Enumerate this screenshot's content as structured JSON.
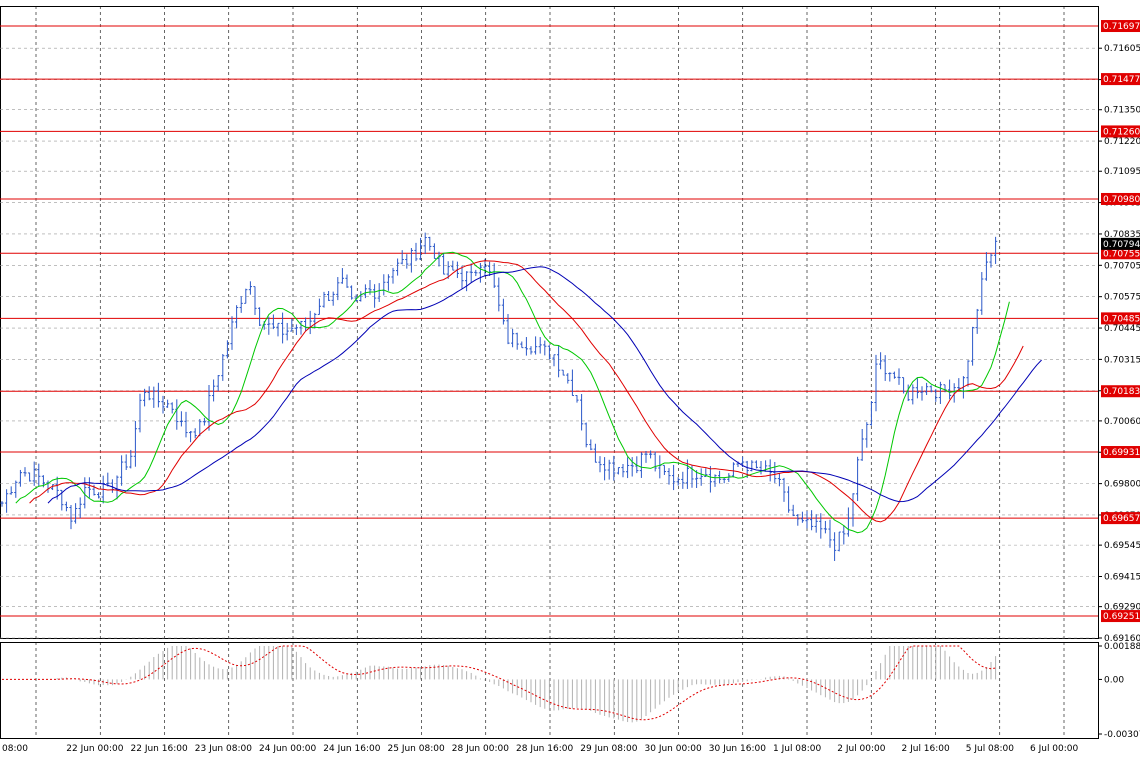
{
  "chart_data": [
    {
      "type": "line",
      "subtype": "candlestick-price-chart",
      "ylim": [
        0.6916,
        0.7178
      ],
      "y_ticks": [
        "0.71605",
        "0.71475",
        "0.71350",
        "0.71220",
        "0.71095",
        "0.70965",
        "0.70835",
        "0.70705",
        "0.70575",
        "0.70445",
        "0.70315",
        "0.70185",
        "0.70060",
        "0.69930",
        "0.69800",
        "0.69670",
        "0.69545",
        "0.69415",
        "0.69290",
        "0.69160"
      ],
      "x_ticks": [
        "08:00",
        "22 Jun 00:00",
        "22 Jun 16:00",
        "23 Jun 08:00",
        "24 Jun 00:00",
        "24 Jun 16:00",
        "25 Jun 08:00",
        "28 Jun 00:00",
        "28 Jun 16:00",
        "29 Jun 08:00",
        "30 Jun 00:00",
        "30 Jun 16:00",
        "1 Jul 08:00",
        "2 Jul 00:00",
        "2 Jul 16:00",
        "5 Jul 08:00",
        "6 Jul 00:00"
      ],
      "current_price": "0.70794",
      "grid": true,
      "levels": [
        {
          "label": "0.71697",
          "value": 0.71697
        },
        {
          "label": "0.71477",
          "value": 0.71477
        },
        {
          "label": "0.71260",
          "value": 0.7126
        },
        {
          "label": "0.70980",
          "value": 0.7098
        },
        {
          "label": "0.70755",
          "value": 0.70755
        },
        {
          "label": "0.70485",
          "value": 0.70485
        },
        {
          "label": "0.70183",
          "value": 0.70183
        },
        {
          "label": "0.69931",
          "value": 0.69931
        },
        {
          "label": "0.69657",
          "value": 0.69657
        },
        {
          "label": "0.69251",
          "value": 0.69251
        }
      ],
      "price_path": [
        [
          0,
          0.6972
        ],
        [
          1.5,
          0.6985
        ],
        [
          3,
          0.6983
        ],
        [
          5,
          0.6975
        ],
        [
          6,
          0.6965
        ],
        [
          7,
          0.6978
        ],
        [
          9,
          0.6977
        ],
        [
          11,
          0.6992
        ],
        [
          12,
          0.702
        ],
        [
          13,
          0.7015
        ],
        [
          14.5,
          0.7012
        ],
        [
          15.5,
          0.7002
        ],
        [
          17,
          0.7003
        ],
        [
          18,
          0.702
        ],
        [
          19,
          0.7035
        ],
        [
          20,
          0.7052
        ],
        [
          21,
          0.7065
        ],
        [
          22,
          0.7048
        ],
        [
          23,
          0.7044
        ],
        [
          24,
          0.7043
        ],
        [
          25,
          0.7045
        ],
        [
          26,
          0.7045
        ],
        [
          27,
          0.7055
        ],
        [
          29,
          0.7063
        ],
        [
          30,
          0.7052
        ],
        [
          31,
          0.706
        ],
        [
          32,
          0.706
        ],
        [
          33,
          0.7068
        ],
        [
          34,
          0.7071
        ],
        [
          35,
          0.7074
        ],
        [
          36,
          0.7082
        ],
        [
          37,
          0.7075
        ],
        [
          37.5,
          0.7067
        ],
        [
          38.5,
          0.7068
        ],
        [
          40,
          0.7065
        ],
        [
          41,
          0.7075
        ],
        [
          42,
          0.706
        ],
        [
          43,
          0.704
        ],
        [
          44,
          0.704
        ],
        [
          45,
          0.7038
        ],
        [
          46,
          0.7035
        ],
        [
          47,
          0.7034
        ],
        [
          48,
          0.7025
        ],
        [
          49,
          0.7016
        ],
        [
          50,
          0.6993
        ],
        [
          51,
          0.699
        ],
        [
          52,
          0.6987
        ],
        [
          54,
          0.6988
        ],
        [
          55,
          0.6993
        ],
        [
          56,
          0.6985
        ],
        [
          57,
          0.6982
        ],
        [
          58,
          0.6983
        ],
        [
          59,
          0.6985
        ],
        [
          60,
          0.6985
        ],
        [
          61,
          0.6982
        ],
        [
          62,
          0.6983
        ],
        [
          63,
          0.699
        ],
        [
          64,
          0.6986
        ],
        [
          65,
          0.6985
        ],
        [
          66,
          0.6982
        ],
        [
          67,
          0.697
        ],
        [
          68,
          0.6963
        ],
        [
          69,
          0.6962
        ],
        [
          70,
          0.696
        ],
        [
          71,
          0.6955
        ],
        [
          72,
          0.696
        ],
        [
          73,
          0.699
        ],
        [
          74,
          0.701
        ],
        [
          74.5,
          0.7027
        ],
        [
          75,
          0.703
        ],
        [
          76,
          0.7025
        ],
        [
          77,
          0.7016
        ],
        [
          78,
          0.702
        ],
        [
          79,
          0.702
        ],
        [
          80,
          0.7018
        ],
        [
          81,
          0.702
        ],
        [
          82,
          0.7023
        ],
        [
          83,
          0.705
        ],
        [
          84,
          0.7073
        ],
        [
          84.8,
          0.7079
        ]
      ],
      "series": [
        {
          "name": "",
          "color": "#00c800",
          "offset": 3
        },
        {
          "name": "",
          "color": "#e00000",
          "offset": 6
        },
        {
          "name": "",
          "color": "#0000b4",
          "offset": 10
        }
      ]
    },
    {
      "type": "bar",
      "subtype": "oscillator",
      "y_ticks": [
        "0.001881",
        "0.00",
        "-0.00307"
      ],
      "ylim": [
        -0.00307,
        0.001881
      ]
    }
  ]
}
